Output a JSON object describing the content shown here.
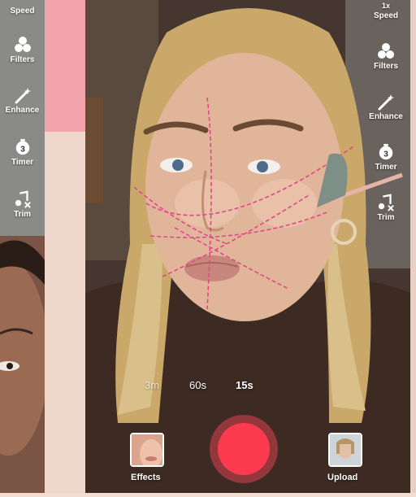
{
  "left_toolbar": {
    "items": [
      {
        "label": "Speed",
        "icon": "speed-icon"
      },
      {
        "label": "Filters",
        "icon": "filters-icon"
      },
      {
        "label": "Enhance",
        "icon": "enhance-wand-icon"
      },
      {
        "label": "Timer",
        "icon": "timer-icon",
        "badge": "3"
      },
      {
        "label": "Trim",
        "icon": "trim-music-icon"
      }
    ]
  },
  "right_toolbar": {
    "items": [
      {
        "label": "Speed",
        "icon": "speed-icon",
        "badge": "1x"
      },
      {
        "label": "Filters",
        "icon": "filters-icon"
      },
      {
        "label": "Enhance",
        "icon": "enhance-wand-icon"
      },
      {
        "label": "Timer",
        "icon": "timer-icon",
        "badge": "3"
      },
      {
        "label": "Trim",
        "icon": "trim-music-icon"
      }
    ]
  },
  "durations": {
    "d3m": "3m",
    "d60s": "60s",
    "d15s": "15s"
  },
  "bottom": {
    "effects_label": "Effects",
    "upload_label": "Upload"
  },
  "colors": {
    "record": "#fc3b50",
    "contour_lines": "#e0488a"
  }
}
